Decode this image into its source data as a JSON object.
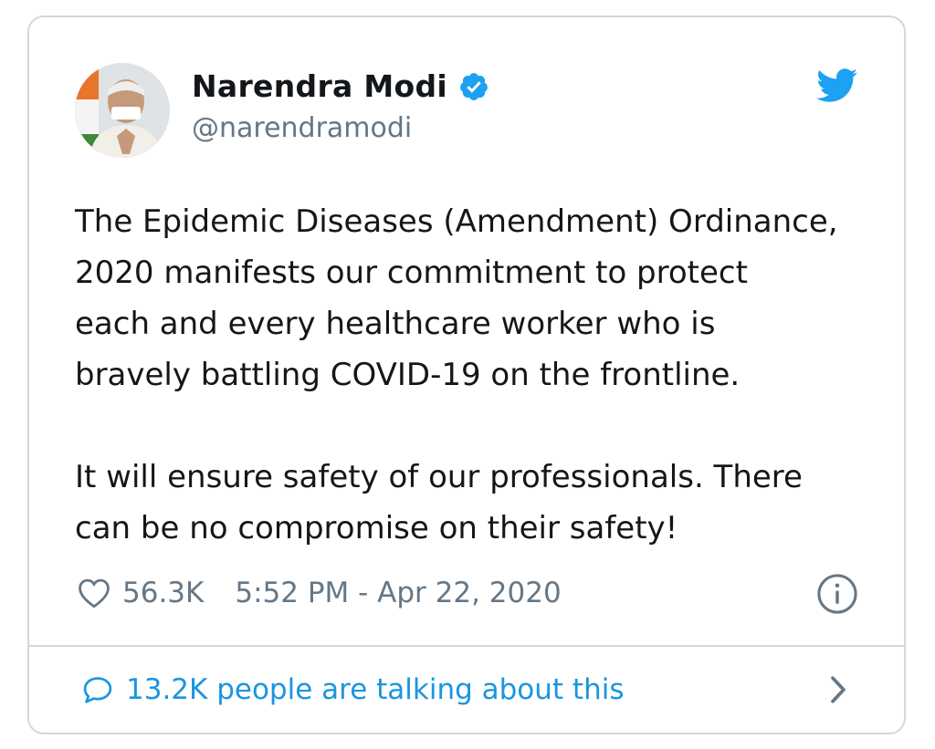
{
  "tweet": {
    "author": {
      "display_name": "Narendra Modi",
      "handle": "@narendramodi",
      "verified": true
    },
    "body": "The Epidemic Diseases (Amendment) Ordinance,\n2020 manifests our commitment to protect\neach and every healthcare worker who is\nbravely battling COVID-19 on the frontline.\n\nIt will ensure safety of our professionals. There\ncan be no compromise on their safety!",
    "likes": "56.3K",
    "timestamp": "5:52 PM - Apr 22, 2020",
    "talking": "13.2K people are talking about this"
  },
  "icons": {
    "verified": "verified-badge-icon",
    "brand": "twitter-bird-icon",
    "like": "heart-icon",
    "info": "info-icon",
    "reply": "speech-bubble-icon",
    "more": "chevron-right-icon"
  },
  "colors": {
    "twitter_blue": "#1da1f2",
    "link_blue": "#1b95e0",
    "text": "#14171a",
    "secondary": "#657786",
    "border": "#cfd9de"
  }
}
